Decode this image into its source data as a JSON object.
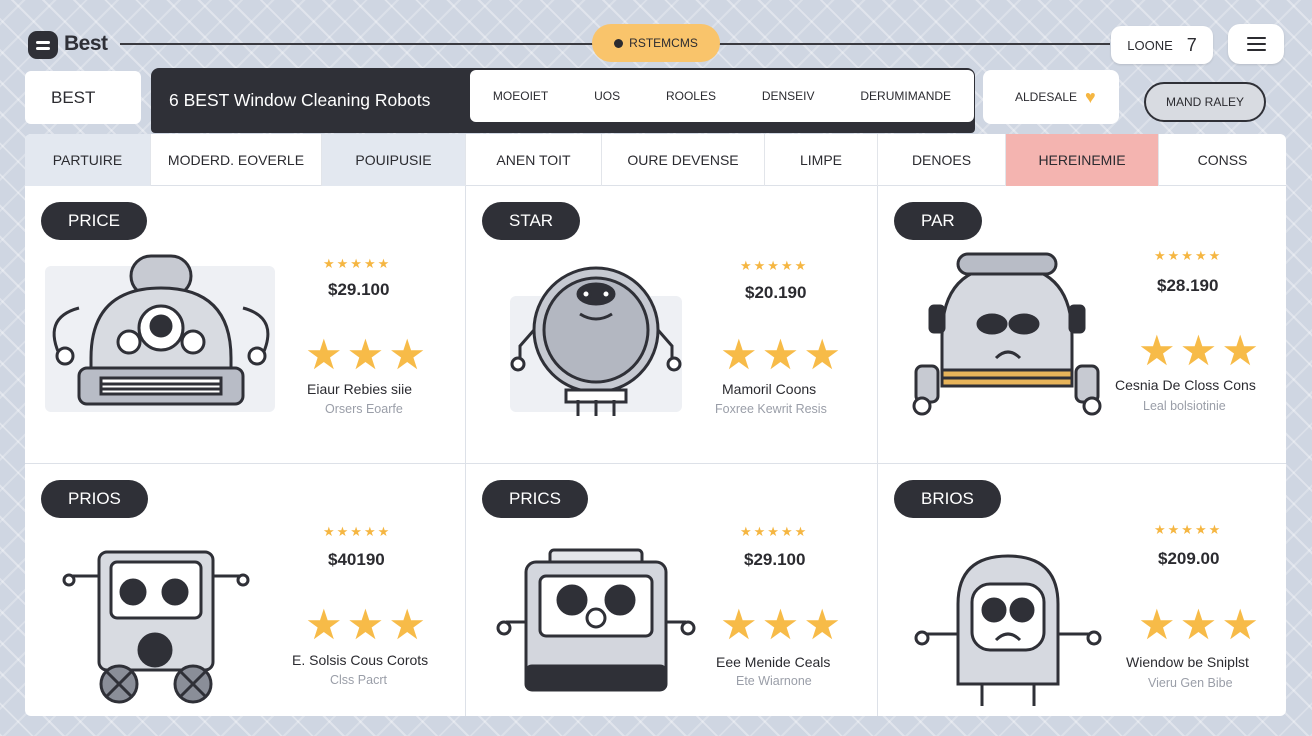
{
  "brand": {
    "name": "Best"
  },
  "top": {
    "center_pill": "RSTEMCMS",
    "login": {
      "label": "LOONE",
      "count": "7"
    }
  },
  "secondbar": {
    "best_label": "BEST",
    "title": "6 BEST Window Cleaning Robots",
    "nav": [
      "MOEOIET",
      "UOS",
      "ROOLES",
      "DENSEIV",
      "DERUMIMANDE"
    ],
    "alert": "ALDESALE",
    "right_button": "MAND RALEY"
  },
  "table": {
    "headers": [
      "PARTUIRE",
      "MODERD. EOVERLE",
      "POUIPUSIE",
      "ANEN TOIT",
      "OURE DEVENSE",
      "LIMPE",
      "DENOES",
      "HEREINEMIE",
      "CONSS"
    ],
    "cards": [
      {
        "badge": "PRICE",
        "small_stars": "★★★★★",
        "price": "$29.100",
        "big_stars": [
          "★",
          "★",
          "★"
        ],
        "desc": "Eiaur Rebies siie",
        "sub": "Orsers Eoarfe"
      },
      {
        "badge": "STAR",
        "small_stars": "★★★★★",
        "price": "$20.190",
        "big_stars": [
          "★",
          "★",
          "★"
        ],
        "desc": "Mamoril Coons",
        "sub": "Foxree Kewrit Resis"
      },
      {
        "badge": "PAR",
        "small_stars": "★★★★★",
        "price": "$28.190",
        "big_stars": [
          "★",
          "★",
          "★"
        ],
        "desc": "Cesnia De Closs Cons",
        "sub": "Leal bolsiotinie"
      },
      {
        "badge": "PRIOS",
        "small_stars": "★★★★★",
        "price": "$40190",
        "big_stars": [
          "★",
          "★",
          "★"
        ],
        "desc": "E. Solsis Cous Corots",
        "sub": "Clss Pacrt"
      },
      {
        "badge": "PRICS",
        "small_stars": "★★★★★",
        "price": "$29.100",
        "big_stars": [
          "★",
          "★",
          "★"
        ],
        "desc": "Eee Menide Ceals",
        "sub": "Ete Wiarnone"
      },
      {
        "badge": "BRIOS",
        "small_stars": "★★★★★",
        "price": "$209.00",
        "big_stars": [
          "★",
          "★",
          "★"
        ],
        "desc": "Wiendow be Sniplst",
        "sub": "Vieru Gen Bibe"
      }
    ]
  },
  "colors": {
    "dark": "#2f3037",
    "accent_yellow": "#f9c46b",
    "star": "#f5b642",
    "highlight_header": "#f4b4b0",
    "light_header": "#e3e8f0"
  }
}
